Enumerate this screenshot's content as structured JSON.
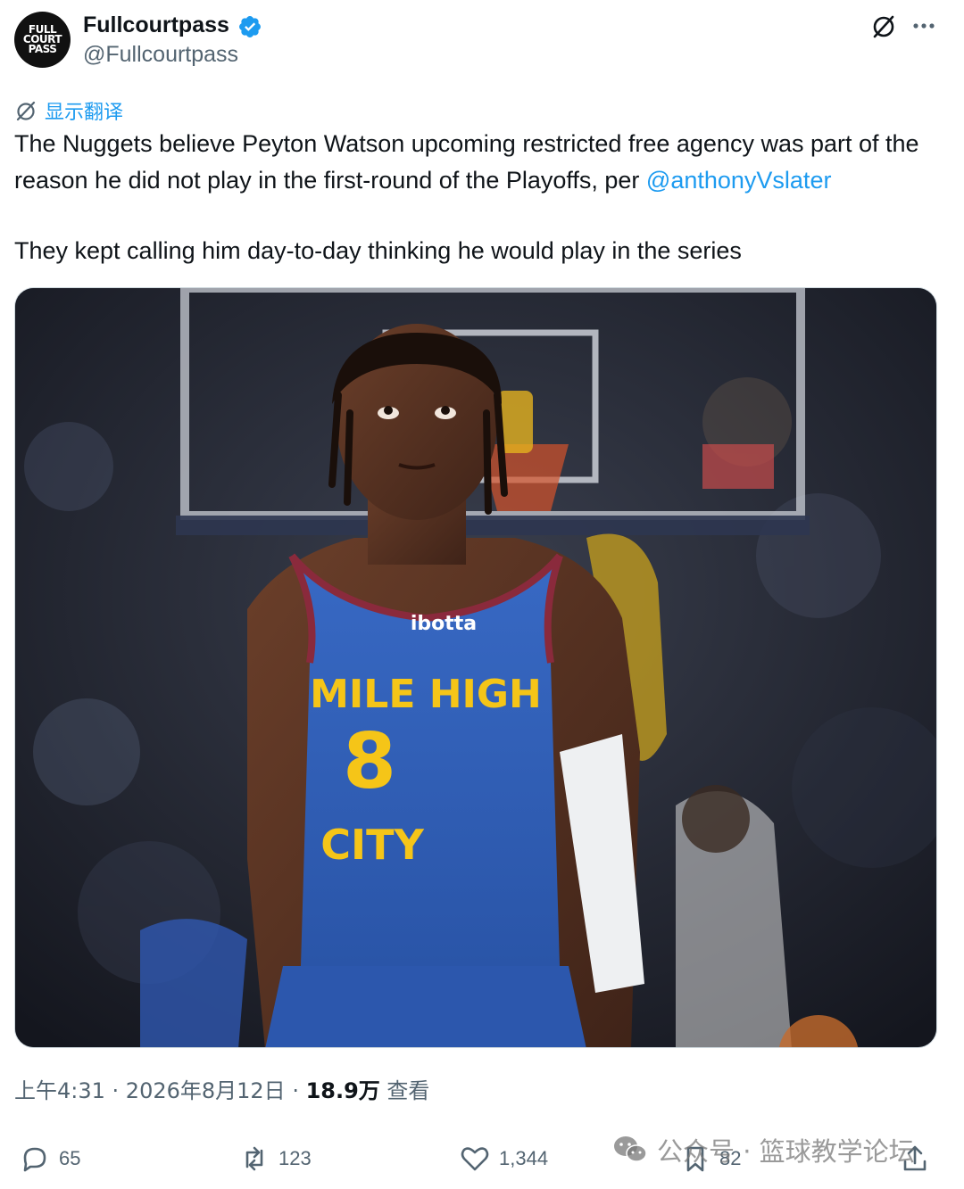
{
  "author": {
    "avatar_text": "FULL\nCOURT\nPASS",
    "display_name": "Fullcourtpass",
    "handle": "@Fullcourtpass",
    "verified": true
  },
  "header_icons": [
    "grok-icon",
    "more-icon"
  ],
  "translate": {
    "label": "显示翻译",
    "icon": "translate-icon"
  },
  "tweet": {
    "line1": "The Nuggets believe Peyton Watson upcoming restricted free agency was part of the reason he did not play in the first-round of the Playoffs, per ",
    "mention": "@anthonyVslater",
    "line2": "They kept calling him day-to-day thinking he would play in the series"
  },
  "media": {
    "jersey_sponsor": "ibotta",
    "jersey_text_top": "MILE HIGH",
    "jersey_number": "8",
    "jersey_text_bottom": "CITY"
  },
  "meta": {
    "time": "上午4:31",
    "sep1": " · ",
    "date": "2026年8月12日",
    "sep2": " · ",
    "views_count": "18.9万",
    "views_label": " 查看"
  },
  "actions": {
    "replies": "65",
    "reposts": "123",
    "likes": "1,344",
    "bookmarks": "82"
  },
  "watermark": {
    "text": "公众号 · 篮球教学论坛"
  },
  "colors": {
    "accent": "#1d9bf0",
    "text": "#0f1419",
    "secondary": "#536471",
    "jersey_blue": "#2f5fb3",
    "jersey_gold": "#f5c518"
  }
}
